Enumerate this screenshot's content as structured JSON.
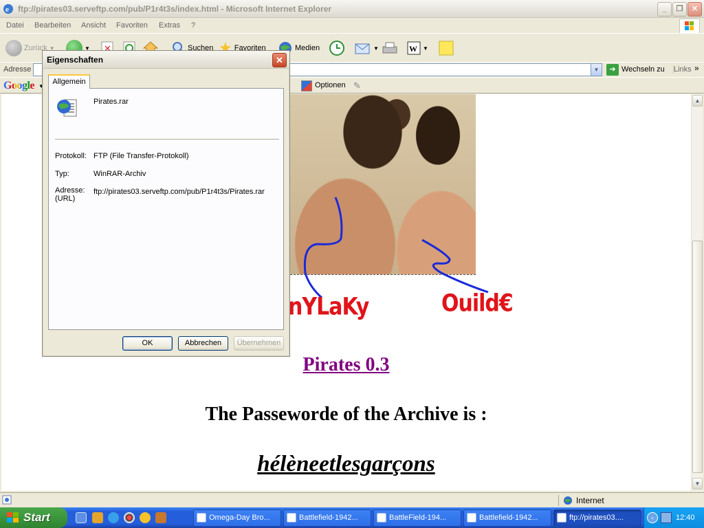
{
  "window": {
    "title": "ftp://pirates03.serveftp.com/pub/P1r4t3s/index.html - Microsoft Internet Explorer",
    "controls": [
      "_",
      "❐",
      "✕"
    ]
  },
  "menu": [
    "Datei",
    "Bearbeiten",
    "Ansicht",
    "Favoriten",
    "Extras",
    "?"
  ],
  "toolbar": {
    "back": "Zurück",
    "search": "Suchen",
    "favorites": "Favoriten",
    "media": "Medien"
  },
  "address": {
    "label": "Adresse",
    "go": "Wechseln zu",
    "links": "Links"
  },
  "google": {
    "logo": "Google",
    "options": "Optionen"
  },
  "page": {
    "label_left": "nYLaKy",
    "label_right": "Ouild€",
    "link": "Pirates 0.3",
    "password_label": "The Passeworde of the Archive is :",
    "password": "hélèneetlesgarçons"
  },
  "dialog": {
    "title": "Eigenschaften",
    "close": "✕",
    "tab": "Allgemein",
    "filename": "Pirates.rar",
    "protocol_label": "Protokoll:",
    "protocol_value": "FTP (File Transfer-Protokoll)",
    "type_label": "Typ:",
    "type_value": "WinRAR-Archiv",
    "address_label": "Adresse:\n(URL)",
    "address_value": "ftp://pirates03.serveftp.com/pub/P1r4t3s/Pirates.rar",
    "ok": "OK",
    "cancel": "Abbrechen",
    "apply": "Übernehmen"
  },
  "status": {
    "zone": "Internet"
  },
  "taskbar": {
    "start": "Start",
    "tasks": [
      {
        "label": "Omega-Day Bro...",
        "active": false
      },
      {
        "label": "Battlefield-1942...",
        "active": false
      },
      {
        "label": "BattleField-194...",
        "active": false
      },
      {
        "label": "Battlefield-1942...",
        "active": false
      },
      {
        "label": "ftp://pirates03....",
        "active": true
      }
    ],
    "clock": "12:40"
  }
}
